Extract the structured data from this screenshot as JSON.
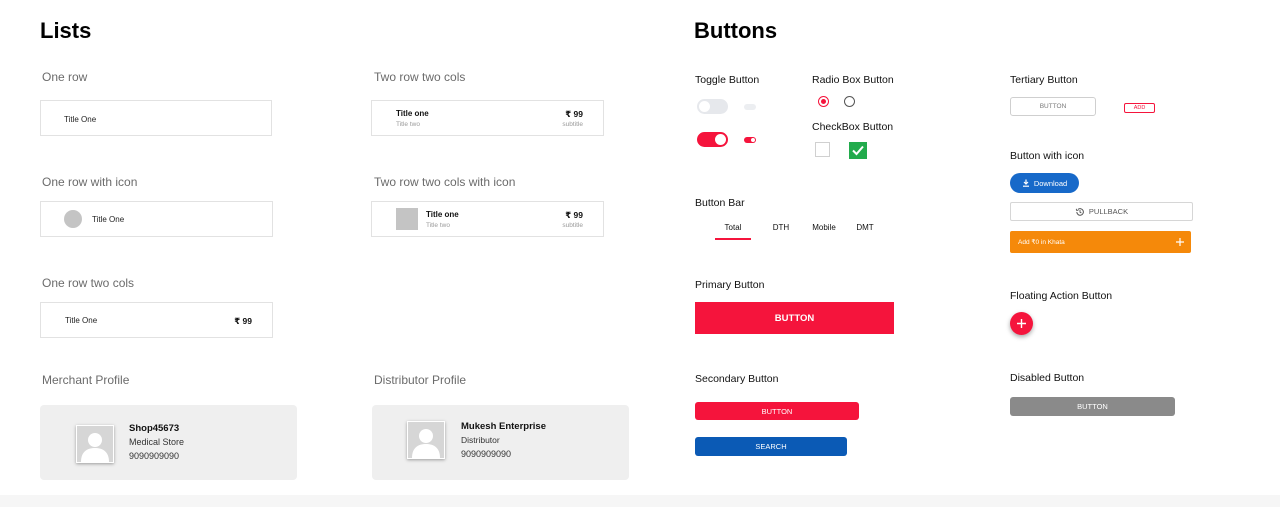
{
  "lists": {
    "title": "Lists",
    "one_row": {
      "label": "One row",
      "item_title": "Title One"
    },
    "two_row_two_cols": {
      "label": "Two row two cols",
      "title": "Title one",
      "subtitle": "Title two",
      "price": "₹ 99",
      "price_sub": "subtitle"
    },
    "one_row_icon": {
      "label": "One row with icon",
      "item_title": "Title One"
    },
    "two_row_two_cols_icon": {
      "label": "Two row two cols with icon",
      "title": "Title one",
      "subtitle": "Title two",
      "price": "₹ 99",
      "price_sub": "subtitle"
    },
    "one_row_two_cols": {
      "label": "One row two cols",
      "item_title": "Title One",
      "price": "₹ 99"
    },
    "merchant": {
      "label": "Merchant Profile",
      "name": "Shop45673",
      "type": "Medical Store",
      "phone": "9090909090"
    },
    "distributor": {
      "label": "Distributor Profile",
      "name": "Mukesh Enterprise",
      "type": "Distributor",
      "phone": "9090909090"
    }
  },
  "buttons": {
    "title": "Buttons",
    "toggle": {
      "label": "Toggle Button"
    },
    "radio": {
      "label": "Radio Box Button"
    },
    "checkbox": {
      "label": "CheckBox Button"
    },
    "bar": {
      "label": "Button Bar",
      "tabs": [
        "Total",
        "DTH",
        "Mobile",
        "DMT"
      ]
    },
    "primary": {
      "label": "Primary Button",
      "text": "BUTTON"
    },
    "secondary": {
      "label": "Secondary Button",
      "red_text": "BUTTON",
      "blue_text": "SEARCH"
    },
    "tertiary": {
      "label": "Tertiary Button",
      "text": "BUTTON",
      "small_text": "ADD"
    },
    "with_icon": {
      "label": "Button with icon",
      "download": "Download",
      "pullback": "PULLBACK",
      "khata": "Add ₹0 in Khata"
    },
    "fab": {
      "label": "Floating Action Button"
    },
    "disabled": {
      "label": "Disabled Button",
      "text": "BUTTON"
    }
  },
  "colors": {
    "brand_red": "#f5143c",
    "blue": "#0b5ab5",
    "download_blue": "#1769c9",
    "orange": "#f5890a",
    "green": "#22ab4c",
    "disabled_gray": "#8a8a8a"
  },
  "icons": [
    "avatar-icon",
    "download-icon",
    "history-icon",
    "plus-icon",
    "check-icon"
  ]
}
